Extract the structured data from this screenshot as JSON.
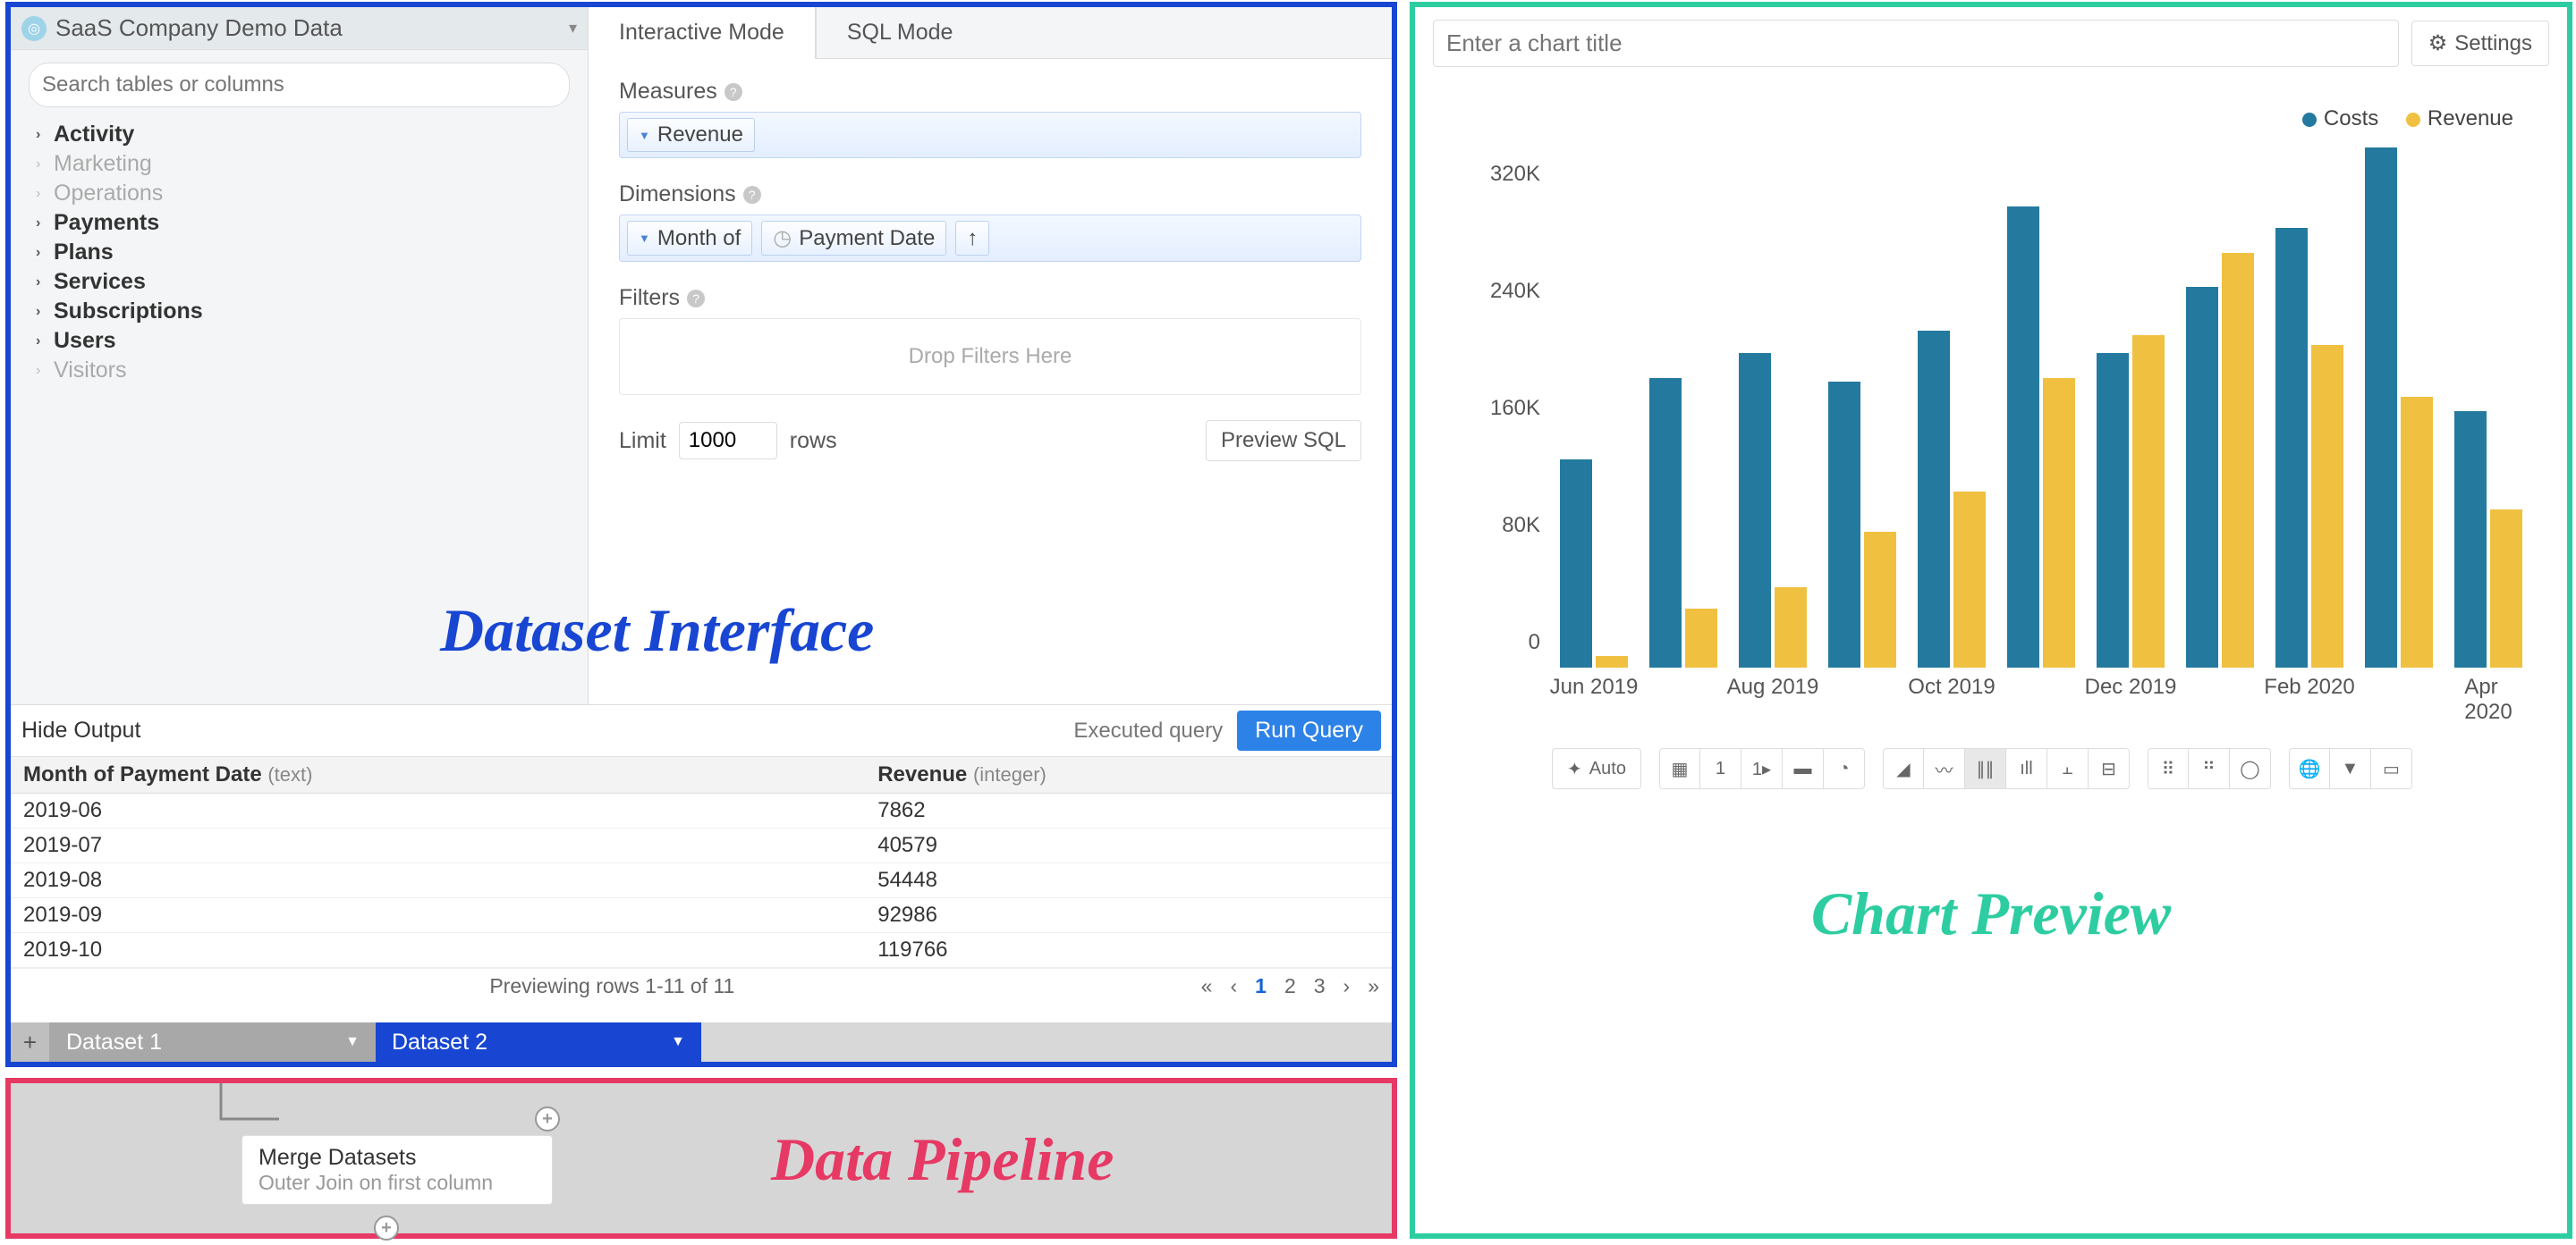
{
  "annotations": {
    "dataset_interface": "Dataset Interface",
    "data_pipeline": "Data Pipeline",
    "chart_preview": "Chart Preview"
  },
  "dataset": {
    "source_name": "SaaS Company Demo Data",
    "search_placeholder": "Search tables or columns",
    "tree": [
      {
        "label": "Activity",
        "bold": true
      },
      {
        "label": "Marketing",
        "bold": false
      },
      {
        "label": "Operations",
        "bold": false
      },
      {
        "label": "Payments",
        "bold": true
      },
      {
        "label": "Plans",
        "bold": true
      },
      {
        "label": "Services",
        "bold": true
      },
      {
        "label": "Subscriptions",
        "bold": true
      },
      {
        "label": "Users",
        "bold": true
      },
      {
        "label": "Visitors",
        "bold": false
      }
    ],
    "mode_tabs": {
      "interactive": "Interactive Mode",
      "sql": "SQL Mode"
    },
    "builder": {
      "measures_label": "Measures",
      "measures": [
        "Revenue"
      ],
      "dimensions_label": "Dimensions",
      "dimensions_prefix": "Month of",
      "dimensions_field": "Payment Date",
      "sort_arrow": "↑",
      "filters_label": "Filters",
      "filters_placeholder": "Drop Filters Here",
      "limit_label": "Limit",
      "limit_value": "1000",
      "limit_suffix": "rows",
      "preview_sql": "Preview SQL"
    },
    "output": {
      "hide_label": "Hide Output",
      "executed_label": "Executed query",
      "run_label": "Run Query",
      "col1": "Month of Payment Date",
      "col1_type": "(text)",
      "col2": "Revenue",
      "col2_type": "(integer)",
      "rows": [
        {
          "c1": "2019-06",
          "c2": "7862"
        },
        {
          "c1": "2019-07",
          "c2": "40579"
        },
        {
          "c1": "2019-08",
          "c2": "54448"
        },
        {
          "c1": "2019-09",
          "c2": "92986"
        },
        {
          "c1": "2019-10",
          "c2": "119766"
        }
      ],
      "footer_info": "Previewing rows 1-11 of 11",
      "pager": [
        "«",
        "‹",
        "1",
        "2",
        "3",
        "›",
        "»"
      ],
      "active_page": "1"
    },
    "tabs": {
      "add": "+",
      "t1": "Dataset 1",
      "t2": "Dataset 2"
    }
  },
  "pipeline": {
    "merge_title": "Merge Datasets",
    "merge_sub": "Outer Join on first column"
  },
  "chart_panel": {
    "title_placeholder": "Enter a chart title",
    "settings_label": "Settings",
    "auto_label": "Auto",
    "legend": {
      "s1": "Costs",
      "s2": "Revenue"
    },
    "colors": {
      "costs": "#247a9e",
      "revenue": "#f0c040"
    }
  },
  "chart_data": {
    "type": "bar",
    "title": "",
    "xlabel": "",
    "ylabel": "",
    "ylim": [
      0,
      360000
    ],
    "yticks": [
      0,
      80000,
      160000,
      240000,
      320000
    ],
    "ytick_labels": [
      "0",
      "80K",
      "160K",
      "240K",
      "320K"
    ],
    "categories": [
      "Jun 2019",
      "Jul 2019",
      "Aug 2019",
      "Sep 2019",
      "Oct 2019",
      "Nov 2019",
      "Dec 2019",
      "Jan 2020",
      "Feb 2020",
      "Mar 2020",
      "Apr 2020"
    ],
    "x_tick_labels_shown": [
      "Jun 2019",
      "Aug 2019",
      "Oct 2019",
      "Dec 2019",
      "Feb 2020",
      "Apr 2020"
    ],
    "series": [
      {
        "name": "Costs",
        "color": "#247a9e",
        "values": [
          142000,
          198000,
          215000,
          195000,
          230000,
          315000,
          215000,
          260000,
          300000,
          355000,
          175000
        ]
      },
      {
        "name": "Revenue",
        "color": "#f0c040",
        "values": [
          8000,
          40000,
          55000,
          93000,
          120000,
          198000,
          227000,
          283000,
          220000,
          185000,
          108000
        ]
      }
    ]
  }
}
